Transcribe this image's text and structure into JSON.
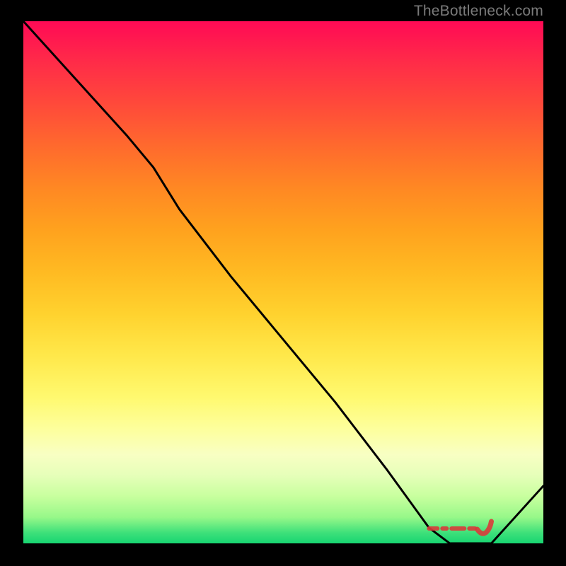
{
  "watermark": "TheBottleneck.com",
  "colors": {
    "background": "#000000",
    "gradient_top": "#ff0a55",
    "gradient_bottom": "#17d571",
    "curve": "#000000",
    "marker": "#d93a3a"
  },
  "chart_data": {
    "type": "line",
    "title": "",
    "subtitle": "",
    "xlabel": "",
    "ylabel": "",
    "xlim": [
      0,
      100
    ],
    "ylim": [
      0,
      100
    ],
    "grid": false,
    "legend": false,
    "series": [
      {
        "name": "bottleneck-curve",
        "x": [
          0,
          10,
          20,
          25,
          30,
          40,
          50,
          60,
          70,
          78,
          82,
          86,
          90,
          100
        ],
        "y": [
          100,
          89,
          78,
          72,
          64,
          51,
          39,
          27,
          14,
          3,
          0,
          0,
          0,
          11
        ]
      }
    ],
    "annotations": [
      {
        "name": "optimal-range",
        "type": "range-marker",
        "x_range": [
          78,
          90
        ],
        "label": ""
      }
    ]
  }
}
